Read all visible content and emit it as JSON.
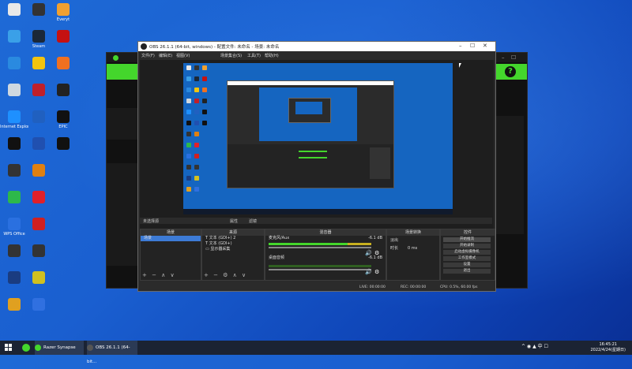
{
  "desktop": {
    "icons": [
      {
        "label": "",
        "icon": "file-icon",
        "color": "#e8e8e8"
      },
      {
        "label": "",
        "icon": "obs-icon",
        "color": "#333333"
      },
      {
        "label": "Everyt",
        "icon": "everything-icon",
        "color": "#f0a030"
      },
      {
        "label": "",
        "icon": "computer-icon",
        "color": "#3aa0e8"
      },
      {
        "label": "Steam",
        "icon": "steam-icon",
        "color": "#1b2838"
      },
      {
        "label": "",
        "icon": "amongus-icon",
        "color": "#c51111"
      },
      {
        "label": "",
        "icon": "network-icon",
        "color": "#2a8ae0"
      },
      {
        "label": "",
        "icon": "qq-icon",
        "color": "#f2c40f"
      },
      {
        "label": "",
        "icon": "app-icon",
        "color": "#f07020"
      },
      {
        "label": "",
        "icon": "recycle-icon",
        "color": "#cfd8e0"
      },
      {
        "label": "",
        "icon": "game-icon",
        "color": "#c0202a"
      },
      {
        "label": "",
        "icon": "logo-icon",
        "color": "#222222"
      },
      {
        "label": "Internet Explorer",
        "icon": "ie-icon",
        "color": "#1e90ff"
      },
      {
        "label": "",
        "icon": "pen-icon",
        "color": "#2060c0"
      },
      {
        "label": "EPIC",
        "icon": "epic-icon",
        "color": "#111111"
      },
      {
        "label": "",
        "icon": "qq-penguin-icon",
        "color": "#111111"
      },
      {
        "label": "",
        "icon": "web-icon",
        "color": "#2050b0"
      },
      {
        "label": "",
        "icon": "capcut-icon",
        "color": "#111111"
      },
      {
        "label": "",
        "icon": "doc-icon",
        "color": "#333333"
      },
      {
        "label": "",
        "icon": "g-icon",
        "color": "#e08010"
      },
      {
        "label": "",
        "icon": "spacer-icon",
        "color": "#1565c0"
      },
      {
        "label": "",
        "icon": "search-icon",
        "color": "#2db84a"
      },
      {
        "label": "",
        "icon": "music-icon",
        "color": "#e0202a"
      },
      {
        "label": "",
        "icon": "spacer-icon",
        "color": "#1565c0"
      },
      {
        "label": "WPS Office",
        "icon": "wps-icon",
        "color": "#2a70e0"
      },
      {
        "label": "",
        "icon": "red-icon",
        "color": "#d02020"
      },
      {
        "label": "",
        "icon": "spacer-icon",
        "color": "#1565c0"
      },
      {
        "label": "",
        "icon": "book-icon",
        "color": "#333333"
      },
      {
        "label": "",
        "icon": "doc2-icon",
        "color": "#333333"
      },
      {
        "label": "",
        "icon": "spacer-icon",
        "color": "#1565c0"
      },
      {
        "label": "",
        "icon": "power-icon",
        "color": "#1a3c80"
      },
      {
        "label": "",
        "icon": "yellow-icon",
        "color": "#d0c020"
      },
      {
        "label": "",
        "icon": "spacer-icon",
        "color": "#1565c0"
      },
      {
        "label": "",
        "icon": "user-icon",
        "color": "#e0a020"
      },
      {
        "label": "",
        "icon": "vpn-icon",
        "color": "#3070e0"
      }
    ]
  },
  "obs": {
    "title": "OBS 26.1.1 (64-bit, windows) - 配置文件: 未命名 - 场景: 未命名",
    "menu": [
      "文件(F)",
      "编辑(E)",
      "视图(V)",
      "",
      "场景集合(S)",
      "工具(T)",
      "帮助(H)"
    ],
    "dock_labels": {
      "studio": "未选择源",
      "gear": "属性",
      "filter": "滤镜"
    },
    "panels": {
      "scenes": {
        "header": "场景",
        "items": [
          "场景"
        ]
      },
      "sources": {
        "header": "来源",
        "items": [
          "文本 (GDI+) 2",
          "文本 (GDI+)",
          "显示器采集"
        ]
      },
      "mixer": {
        "header": "混音器",
        "tracks": [
          {
            "name": "麦克风/Aux",
            "db": "-6.1 dB"
          },
          {
            "name": "桌面音频",
            "db": "-6.1 dB"
          }
        ]
      },
      "transitions": {
        "header": "场景转换",
        "type": "淡出",
        "duration_label": "时长",
        "duration": "0 ms"
      },
      "controls": {
        "header": "控件",
        "buttons": [
          "开始推流",
          "开始录制",
          "启动虚拟摄像机",
          "工作室模式",
          "设置",
          "退出"
        ]
      }
    },
    "status": {
      "live": "LIVE: 00:00:00",
      "rec": "REC: 00:00:00",
      "cpu": "CPU: 0.5%, 60.00 fps"
    }
  },
  "taskbar": {
    "items": [
      {
        "label": "Razer Synapse",
        "color": "#44d62c"
      },
      {
        "label": "OBS 26.1.1 (64-bit...",
        "color": "#333333"
      }
    ],
    "tray": "^ ◉ ▲ 中 ☐",
    "time": "16:45:21",
    "date": "2022/4/24(星期日)"
  },
  "colors": {
    "accent": "#44d62c",
    "obs_bg": "#2b2b2b",
    "desktop": "#1565c0"
  }
}
